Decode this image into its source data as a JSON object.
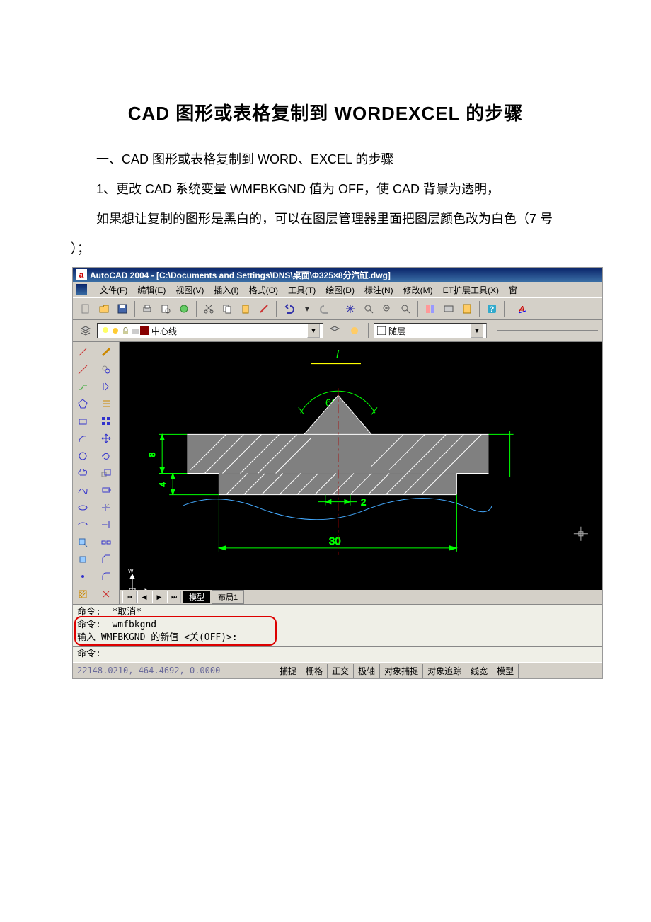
{
  "document": {
    "title": "CAD 图形或表格复制到 WORDEXCEL 的步骤",
    "para1": "一、CAD 图形或表格复制到 WORD、EXCEL 的步骤",
    "para2": "1、更改 CAD 系统变量 WMFBKGND 值为 OFF，使 CAD 背景为透明，",
    "para3": "如果想让复制的图形是黑白的，可以在图层管理器里面把图层颜色改为白色（7 号",
    "para3_tail": "）；"
  },
  "cad": {
    "app_icon": "a",
    "title": "AutoCAD 2004 - [C:\\Documents and Settings\\DNS\\桌面\\Φ325×8分汽缸.dwg]",
    "menu": {
      "file": "文件(F)",
      "edit": "编辑(E)",
      "view": "视图(V)",
      "insert": "插入(I)",
      "format": "格式(O)",
      "tools": "工具(T)",
      "draw": "绘图(D)",
      "dim": "标注(N)",
      "modify": "修改(M)",
      "ext": "ET扩展工具(X)",
      "window": "窗"
    },
    "layer": {
      "current": "中心线",
      "color_label": "随层"
    },
    "tabs": {
      "model": "模型",
      "layout1": "布局1"
    },
    "drawing": {
      "angle": "60°",
      "dim1": "2",
      "dim2": "30",
      "label_top": "I",
      "dim_left1": "8",
      "dim_left2": "4"
    },
    "cmd": {
      "l1": "命令:  *取消*",
      "l2": "命令:  wmfbkgnd",
      "l3": "输入 WMFBKGND 的新值 <关(OFF)>:",
      "l4": "命令:"
    },
    "status": {
      "coords": "22148.0210, 464.4692, 0.0000",
      "snap": "捕捉",
      "grid": "栅格",
      "ortho": "正交",
      "polar": "极轴",
      "osnap": "对象捕捉",
      "otrack": "对象追踪",
      "lwt": "线宽",
      "model": "模型"
    }
  }
}
